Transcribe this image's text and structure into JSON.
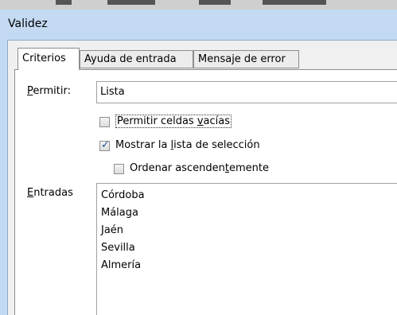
{
  "window": {
    "title": "Validez"
  },
  "tabs": [
    {
      "label": "Criterios",
      "active": true
    },
    {
      "label": "Ayuda de entrada",
      "active": false
    },
    {
      "label": "Mensaje de error",
      "active": false
    }
  ],
  "criteria": {
    "allow": {
      "label_accel": "P",
      "label_rest": "ermitir:",
      "value": "Lista"
    },
    "allow_empty": {
      "label_a": "Permitir celdas ",
      "label_accel": "v",
      "label_b": "acías",
      "checked": false
    },
    "show_list": {
      "label_a": "Mostrar la ",
      "label_accel": "l",
      "label_b": "ista de selección",
      "checked": true
    },
    "sort_asc": {
      "label_a": "Ordenar ascenden",
      "label_accel": "t",
      "label_b": "emente",
      "checked": false
    },
    "entries": {
      "label_accel": "E",
      "label_rest": "ntradas",
      "items": [
        "Córdoba",
        "Málaga",
        "Jaén",
        "Sevilla",
        "Almería"
      ]
    }
  },
  "checkmark": "✓"
}
